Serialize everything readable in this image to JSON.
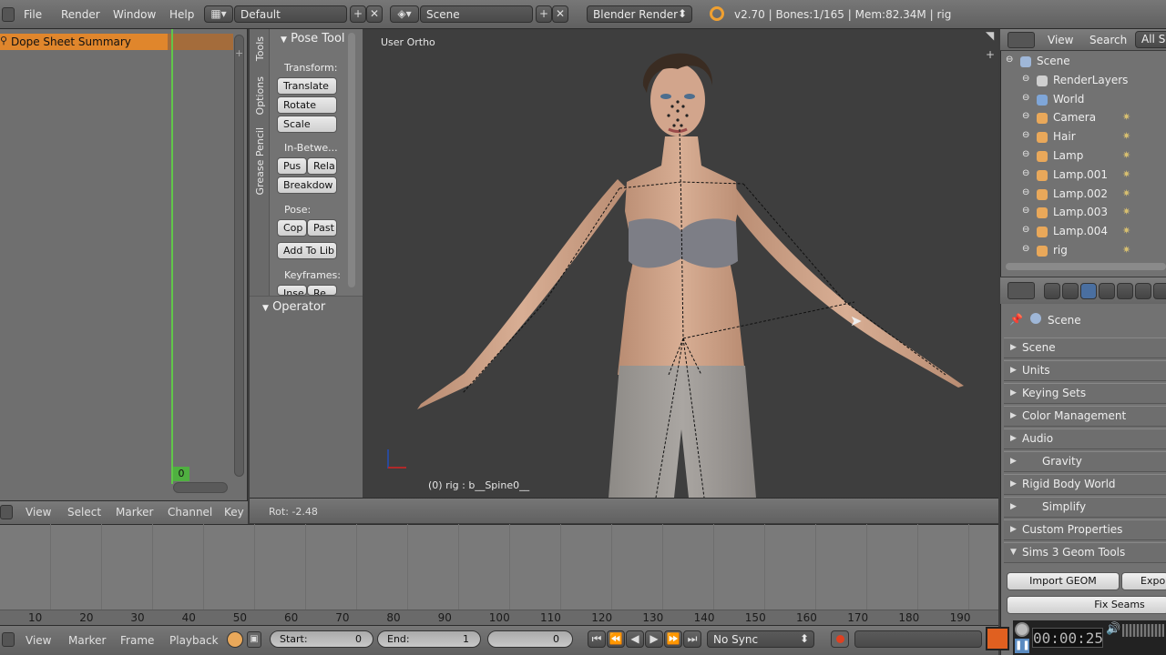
{
  "top_bar": {
    "menus": [
      "File",
      "Render",
      "Window",
      "Help"
    ],
    "layout_name": "Default",
    "scene_name": "Scene",
    "render_engine": "Blender Render",
    "info": "v2.70 | Bones:1/165 | Mem:82.34M | rig"
  },
  "dope_sheet": {
    "summary": "Dope Sheet Summary",
    "current_frame": "0",
    "menus": [
      "View",
      "Select",
      "Marker",
      "Channel",
      "Key"
    ]
  },
  "tool_shelf": {
    "tabs": [
      "Tools",
      "Options",
      "Grease Pencil"
    ],
    "panel_title": "Pose Tool",
    "transform_label": "Transform:",
    "translate": "Translate",
    "rotate": "Rotate",
    "scale": "Scale",
    "inbetween_label": "In-Betwe...",
    "push": "Pus",
    "relax": "Rela",
    "breakdown": "Breakdow",
    "pose_label": "Pose:",
    "copy": "Cop",
    "paste": "Past",
    "add_to_lib": "Add To Lib",
    "keyframes_label": "Keyframes:",
    "insert": "Inse",
    "remove": "Re",
    "operator": "Operator"
  },
  "viewport": {
    "label": "User Ortho",
    "active_object": "(0) rig : b__Spine0__",
    "rotation": "Rot: -2.48"
  },
  "timeline": {
    "ticks": [
      "10",
      "20",
      "30",
      "40",
      "50",
      "60",
      "70",
      "80",
      "90",
      "100",
      "110",
      "120",
      "130",
      "140",
      "150",
      "160",
      "170",
      "180",
      "190"
    ],
    "menus": [
      "View",
      "Marker",
      "Frame",
      "Playback"
    ],
    "start_label": "Start:",
    "start_value": "0",
    "end_label": "End:",
    "end_value": "1",
    "current_value": "0",
    "sync": "No Sync",
    "clock": "00:00:25"
  },
  "outliner": {
    "menus": [
      "View",
      "Search",
      "All Sc"
    ],
    "items": [
      {
        "label": "Scene",
        "color": "#9fb7d8"
      },
      {
        "label": "RenderLayers",
        "color": "#cfcfcf"
      },
      {
        "label": "World",
        "color": "#7fa6d8"
      },
      {
        "label": "Camera",
        "color": "#e9a85a"
      },
      {
        "label": "Hair",
        "color": "#e9a85a"
      },
      {
        "label": "Lamp",
        "color": "#e9a85a"
      },
      {
        "label": "Lamp.001",
        "color": "#e9a85a"
      },
      {
        "label": "Lamp.002",
        "color": "#e9a85a"
      },
      {
        "label": "Lamp.003",
        "color": "#e9a85a"
      },
      {
        "label": "Lamp.004",
        "color": "#e9a85a"
      },
      {
        "label": "rig",
        "color": "#e9a85a"
      }
    ]
  },
  "properties": {
    "context": "Scene",
    "panels": [
      "Scene",
      "Units",
      "Keying Sets",
      "Color Management",
      "Audio",
      "Gravity",
      "Rigid Body World",
      "Simplify",
      "Custom Properties",
      "Sims 3 Geom Tools"
    ],
    "import_geom": "Import GEOM",
    "export": "Expo",
    "fix_seams": "Fix Seams"
  }
}
